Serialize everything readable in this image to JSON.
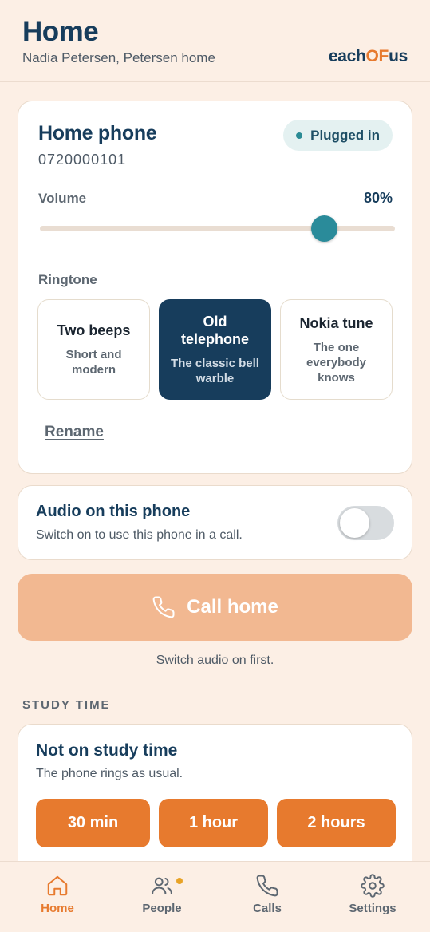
{
  "header": {
    "title": "Home",
    "subtitle": "Nadia Petersen, Petersen home",
    "logo_part1": "each",
    "logo_part2": "OF",
    "logo_part3": "us"
  },
  "phone": {
    "title": "Home phone",
    "number": "0720000101",
    "status": "Plugged in",
    "volume_label": "Volume",
    "volume_value": "80%",
    "volume_level": 0.8,
    "ringtone_label": "Ringtone",
    "ringtones": [
      {
        "title": "Two beeps",
        "desc": "Short and modern",
        "selected": false
      },
      {
        "title": "Old telephone",
        "desc": "The classic bell warble",
        "selected": true
      },
      {
        "title": "Nokia tune",
        "desc": "The one everybody knows",
        "selected": false
      }
    ],
    "rename": "Rename"
  },
  "audio": {
    "title": "Audio on this phone",
    "desc": "Switch on to use this phone in a call.",
    "enabled": false
  },
  "call": {
    "label": "Call home",
    "hint": "Switch audio on first."
  },
  "study": {
    "section": "STUDY TIME",
    "title": "Not on study time",
    "desc": "The phone rings as usual.",
    "options": [
      "30 min",
      "1 hour",
      "2 hours"
    ]
  },
  "nav": {
    "items": [
      {
        "label": "Home",
        "icon": "home-icon",
        "active": true
      },
      {
        "label": "People",
        "icon": "people-icon",
        "active": false,
        "badge": true
      },
      {
        "label": "Calls",
        "icon": "phone-icon",
        "active": false
      },
      {
        "label": "Settings",
        "icon": "gear-icon",
        "active": false
      }
    ]
  },
  "colors": {
    "accent": "#e77a2e",
    "primary": "#173d5c",
    "teal": "#2a8b9a",
    "background": "#fcefe5"
  }
}
